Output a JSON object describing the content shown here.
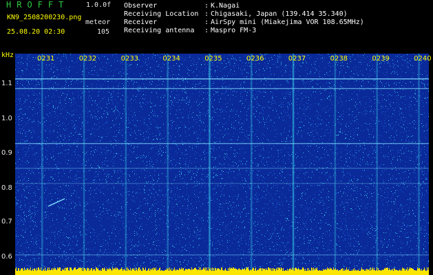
{
  "header": {
    "app_title": "HROFFT",
    "version": "1.0.0f",
    "filename": "KN9_2508200230.png",
    "meteor_label": "meteor",
    "datetime": "25.08.20 02:30",
    "meteor_count": "105"
  },
  "info": [
    {
      "key": "Observer",
      "value": "K.Nagai"
    },
    {
      "key": "Receiving Location",
      "value": "Chigasaki, Japan (139.414 35.340)"
    },
    {
      "key": "Receiver",
      "value": "AirSpy mini (Miakejima VOR 108.65MHz)"
    },
    {
      "key": "Receiving antenna",
      "value": "Maspro FM-3"
    }
  ],
  "axis": {
    "y_unit": "kHz",
    "y_ticks": [
      "1.1",
      "1.0",
      "0.9",
      "0.8",
      "0.7",
      "0.6"
    ],
    "x_ticks": [
      "0231",
      "0232",
      "0233",
      "0234",
      "0235",
      "0236",
      "0237",
      "0238",
      "0239",
      "0240"
    ]
  },
  "colors": {
    "background": "#0a2a9a",
    "noise_dim": "#1f5fd0",
    "noise_bright": "#37c8e6",
    "signal_line": "#7fe0ff",
    "baseline": "#ffe600"
  }
}
